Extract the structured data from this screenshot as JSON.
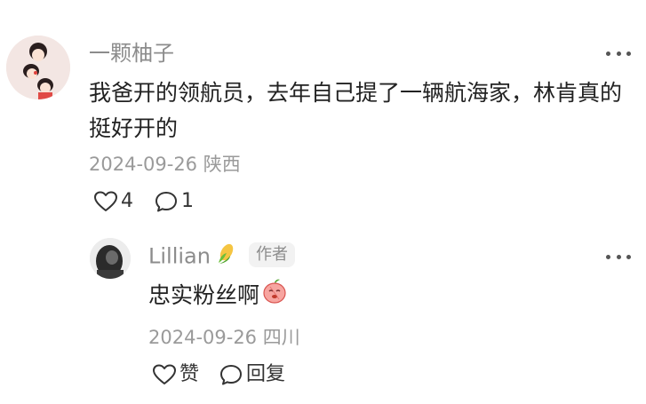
{
  "comment": {
    "author": "一颗柚子",
    "text": "我爸开的领航员，去年自己提了一辆航海家，林肯真的挺好开的",
    "date": "2024-09-26",
    "location": "陕西",
    "like_count": "4",
    "reply_count": "1"
  },
  "reply": {
    "author": "Lillian",
    "badge": "作者",
    "text": "忠实粉丝啊",
    "date": "2024-09-26",
    "location": "四川",
    "like_label": "赞",
    "reply_label": "回复"
  },
  "icons": {
    "more": "more-dots-icon",
    "like": "heart-outline-icon",
    "comment": "comment-bubble-icon",
    "name_emoji": "corn-emoji-icon",
    "text_emoji": "peach-face-emoji-icon"
  }
}
